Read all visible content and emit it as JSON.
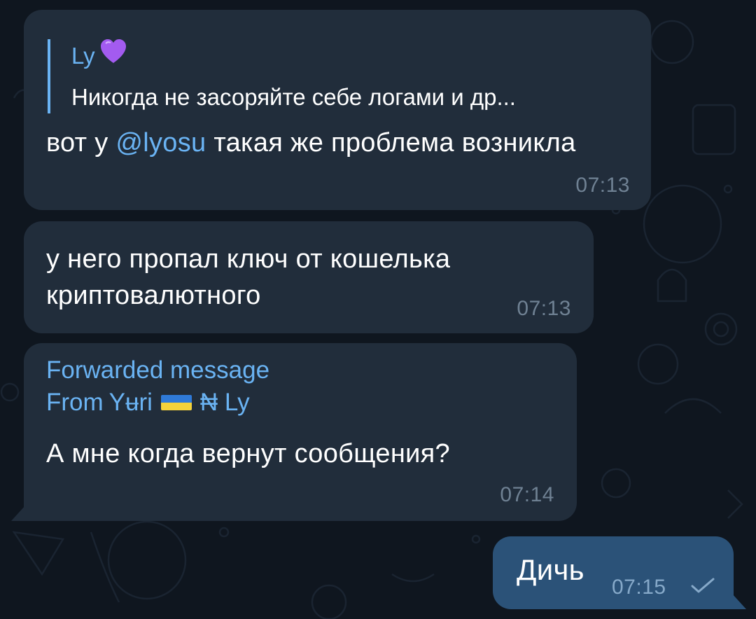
{
  "messages": [
    {
      "reply": {
        "author": "Ly",
        "author_emoji": "heart-purple",
        "text": "Никогда не засоряйте себе логами и др..."
      },
      "text_before": "вот у ",
      "mention": "@lyosu",
      "text_after": " такая же проблема возникла",
      "time": "07:13"
    },
    {
      "text": "у него пропал ключ от кошелька криптовалютного",
      "time": "07:13"
    },
    {
      "forwarded_label": "Forwarded message",
      "from_prefix": "From",
      "from_name": "Yʉri",
      "from_flag": "ukraine-flag",
      "from_suffix": "₦ Ly",
      "text": "А мне когда вернут сообщения?",
      "time": "07:14"
    },
    {
      "text": "Дичь",
      "time": "07:15",
      "status_icon": "check-icon"
    }
  ],
  "colors": {
    "background": "#0f161f",
    "incoming_bubble": "#212d3b",
    "outgoing_bubble": "#2b5278",
    "accent": "#6ab3f3"
  }
}
